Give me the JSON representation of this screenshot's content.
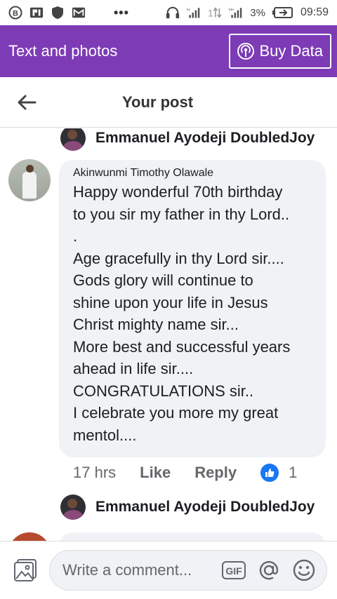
{
  "status_bar": {
    "battery": "3%",
    "time": "09:59",
    "icons": [
      "b-circle-icon",
      "p-box-icon",
      "shield-icon",
      "mail-icon",
      "more-dots-icon",
      "headset-icon",
      "signal-icon",
      "data-arrows-icon",
      "signal-icon",
      "battery-icon"
    ]
  },
  "banner": {
    "title": "Text and photos",
    "buy_label": "Buy Data"
  },
  "header": {
    "title": "Your post"
  },
  "comments": [
    {
      "reply_from": "Emmanuel Ayodeji DoubledJoy",
      "author": "Akinwunmi Timothy Olawale",
      "lines": [
        "Happy wonderful 70th birthday",
        "to you sir my father in thy Lord..",
        ".",
        "Age gracefully in thy Lord sir....",
        "Gods glory will continue to",
        "shine upon your life in Jesus",
        "Christ mighty name sir...",
        "More best and successful years",
        "ahead in life sir....",
        "CONGRATULATIONS sir..",
        "I celebrate you more my great",
        "mentol...."
      ],
      "time": "17 hrs",
      "like_label": "Like",
      "reply_label": "Reply",
      "reaction_count": "1",
      "reply_after": "Emmanuel Ayodeji DoubledJoy"
    }
  ],
  "composer": {
    "placeholder": "Write a comment...",
    "gif_label": "GIF"
  },
  "colors": {
    "banner_purple": "#7d3bb5",
    "bubble_gray": "#f0f2f5",
    "like_blue": "#1877f2"
  }
}
